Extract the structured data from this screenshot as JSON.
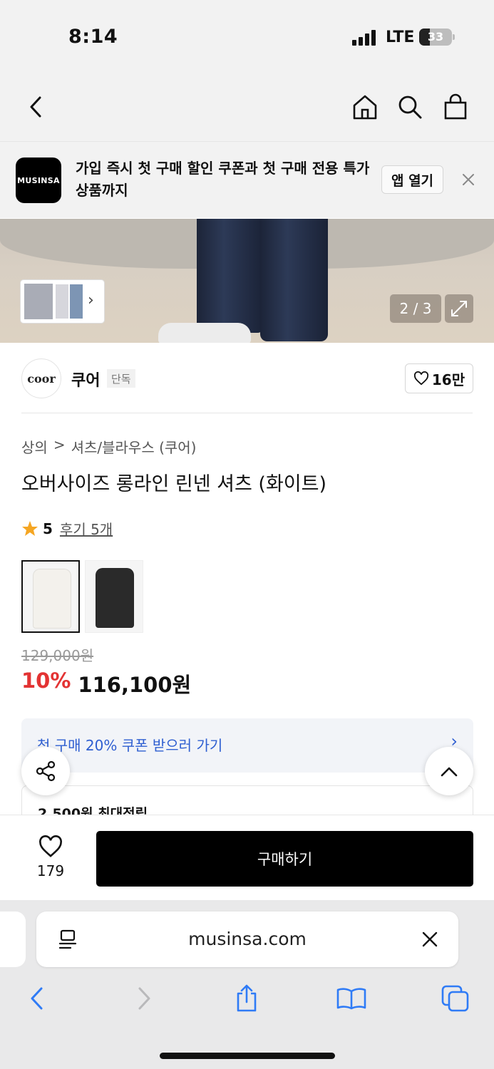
{
  "status_bar": {
    "time": "8:14",
    "network": "LTE",
    "battery": "33",
    "battery_level": 0.33
  },
  "nav": {
    "back_icon": "chevron-left-icon",
    "home_icon": "home-icon",
    "search_icon": "search-icon",
    "cart_icon": "shopping-bag-icon"
  },
  "app_banner": {
    "logo": "MUSINSA",
    "text": "가입 즉시 첫 구매 할인 쿠폰과 첫 구매 전용 특가 상품까지",
    "open_app": "앱 열기",
    "close_icon": "close-icon"
  },
  "gallery": {
    "page_indicator": "2 / 3",
    "thumb_chevron": "›",
    "expand_icon": "expand-icon"
  },
  "brand": {
    "logo": "coor",
    "name": "쿠어",
    "badge": "단독",
    "likes": "16만"
  },
  "product": {
    "breadcrumb": [
      "상의",
      ">",
      "셔츠/블라우스 (쿠어)"
    ],
    "title": "오버사이즈 롱라인 린넨 셔츠 (화이트)",
    "rating": "5",
    "reviews": "후기 5개",
    "colors": [
      {
        "name": "white",
        "hex": "#f3f1ec"
      },
      {
        "name": "black",
        "hex": "#2a2a2a"
      }
    ],
    "original_price": "129,000원",
    "discount": "10%",
    "sale_price": "116,100원"
  },
  "coupon": {
    "text": "첫 구매 20% 쿠폰 받으러 가기",
    "chevron": "›"
  },
  "points": {
    "text": "2,500원 최대적립"
  },
  "bottom_bar": {
    "wish_count": "179",
    "buy_label": "구매하기"
  },
  "safari": {
    "url": "musinsa.com"
  },
  "colors": {
    "accent_sale": "#e33333",
    "coupon_blue": "#2f5fd1",
    "safari_blue": "#2f7bf6"
  }
}
